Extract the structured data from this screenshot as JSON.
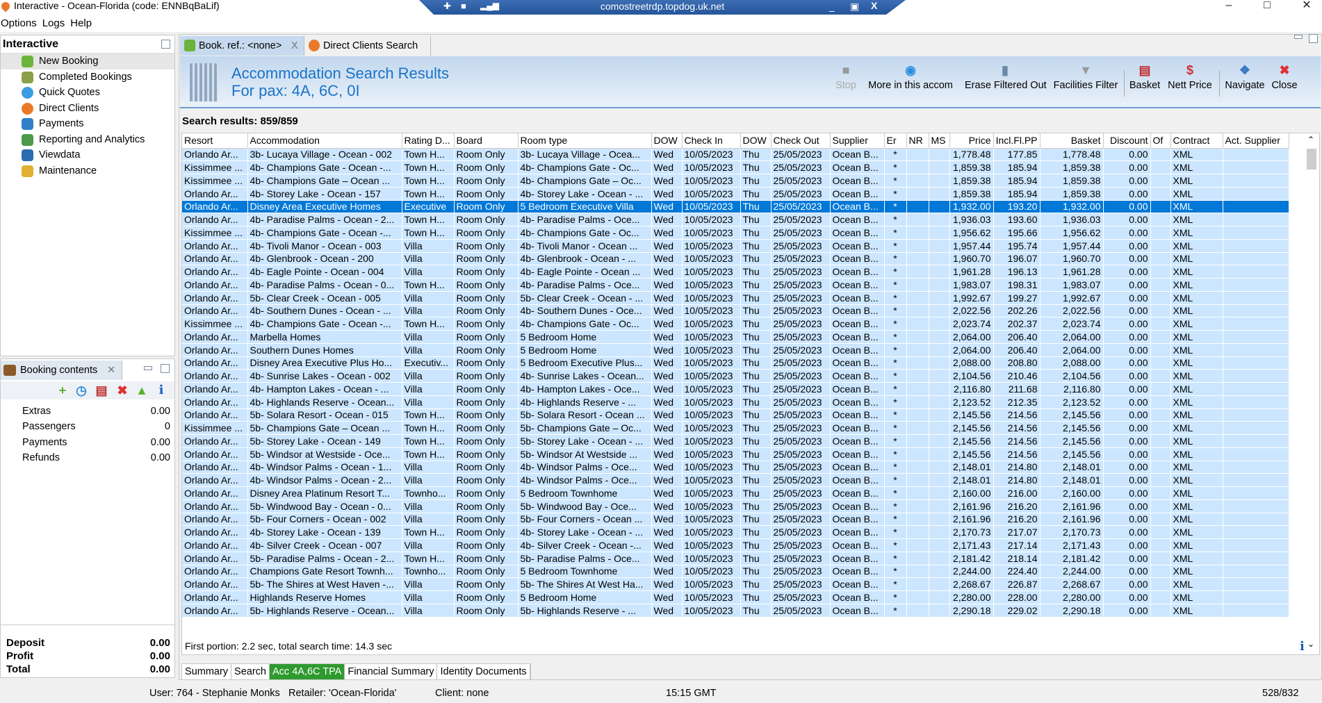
{
  "window": {
    "title": "Interactive - Ocean-Florida (code: ENNBqBaLif)",
    "rdp_host": "comostreetrdp.topdog.uk.net"
  },
  "menu": [
    "Options",
    "Logs",
    "Help"
  ],
  "nav": {
    "title": "Interactive",
    "items": [
      "New Booking",
      "Completed Bookings",
      "Quick Quotes",
      "Direct Clients",
      "Payments",
      "Reporting and Analytics",
      "Viewdata",
      "Maintenance"
    ]
  },
  "booking": {
    "tab": "Booking contents",
    "rows": [
      {
        "k": "Extras",
        "v": "0.00"
      },
      {
        "k": "Passengers",
        "v": "0"
      },
      {
        "k": "Payments",
        "v": "0.00"
      },
      {
        "k": "Refunds",
        "v": "0.00"
      }
    ],
    "totals": [
      {
        "k": "Deposit",
        "v": "0.00"
      },
      {
        "k": "Profit",
        "v": "0.00"
      },
      {
        "k": "Total",
        "v": "0.00"
      }
    ]
  },
  "tabs": [
    {
      "label": "Book. ref.: <none>",
      "close": "X"
    },
    {
      "label": "Direct Clients Search"
    }
  ],
  "header": {
    "title": "Accommodation Search Results",
    "subtitle": "For pax: 4A, 6C, 0I"
  },
  "toolbar": [
    "Stop",
    "More in this accom",
    "Erase Filtered Out",
    "Facilities Filter",
    "Basket",
    "Nett Price",
    "Navigate",
    "Close"
  ],
  "results_label": "Search results: 859/859",
  "columns": [
    "Resort",
    "Accommodation",
    "Rating D...",
    "Board",
    "Room type",
    "DOW",
    "Check In",
    "DOW",
    "Check Out",
    "Supplier",
    "Er",
    "NR",
    "MS",
    "Price",
    "Incl.Fl.PP",
    "Basket",
    "Discount",
    "Of",
    "Contract",
    "Act. Supplier"
  ],
  "common": {
    "board": "Room Only",
    "dow_in": "Wed",
    "check_in": "10/05/2023",
    "dow_out": "Thu",
    "check_out": "25/05/2023",
    "supplier": "Ocean B...",
    "er": "*",
    "nr": "",
    "ms": "",
    "discount": "0.00",
    "of": "",
    "contract": "XML",
    "act_supplier": ""
  },
  "selected_row": 4,
  "rows": [
    [
      "Orlando Ar...",
      "3b- Lucaya Village - Ocean - 002",
      "Town H...",
      "3b- Lucaya Village - Ocea...",
      "1,778.48",
      "177.85",
      "1,778.48"
    ],
    [
      "Kissimmee ...",
      "4b- Champions Gate - Ocean -...",
      "Town H...",
      "4b- Champions Gate - Oc...",
      "1,859.38",
      "185.94",
      "1,859.38"
    ],
    [
      "Kissimmee ...",
      "4b- Champions Gate – Ocean ...",
      "Town H...",
      "4b- Champions Gate – Oc...",
      "1,859.38",
      "185.94",
      "1,859.38"
    ],
    [
      "Orlando Ar...",
      "4b- Storey Lake - Ocean - 157",
      "Town H...",
      "4b- Storey Lake - Ocean - ...",
      "1,859.38",
      "185.94",
      "1,859.38"
    ],
    [
      "Orlando Ar...",
      "Disney Area Executive Homes",
      "Executive",
      "5 Bedroom Executive Villa",
      "1,932.00",
      "193.20",
      "1,932.00"
    ],
    [
      "Orlando Ar...",
      "4b- Paradise Palms - Ocean - 2...",
      "Town H...",
      "4b- Paradise Palms - Oce...",
      "1,936.03",
      "193.60",
      "1,936.03"
    ],
    [
      "Kissimmee ...",
      "4b- Champions Gate - Ocean -...",
      "Town H...",
      "4b- Champions Gate - Oc...",
      "1,956.62",
      "195.66",
      "1,956.62"
    ],
    [
      "Orlando Ar...",
      "4b- Tivoli Manor - Ocean - 003",
      "Villa",
      "4b- Tivoli Manor - Ocean ...",
      "1,957.44",
      "195.74",
      "1,957.44"
    ],
    [
      "Orlando Ar...",
      "4b- Glenbrook - Ocean - 200",
      "Villa",
      "4b- Glenbrook - Ocean - ...",
      "1,960.70",
      "196.07",
      "1,960.70"
    ],
    [
      "Orlando Ar...",
      "4b- Eagle Pointe - Ocean - 004",
      "Villa",
      "4b- Eagle Pointe - Ocean ...",
      "1,961.28",
      "196.13",
      "1,961.28"
    ],
    [
      "Orlando Ar...",
      "4b- Paradise Palms - Ocean - 0...",
      "Town H...",
      "4b- Paradise Palms - Oce...",
      "1,983.07",
      "198.31",
      "1,983.07"
    ],
    [
      "Orlando Ar...",
      "5b- Clear Creek - Ocean - 005",
      "Villa",
      "5b- Clear Creek - Ocean - ...",
      "1,992.67",
      "199.27",
      "1,992.67"
    ],
    [
      "Orlando Ar...",
      "4b- Southern Dunes - Ocean - ...",
      "Villa",
      "4b- Southern Dunes - Oce...",
      "2,022.56",
      "202.26",
      "2,022.56"
    ],
    [
      "Kissimmee ...",
      "4b- Champions Gate - Ocean -...",
      "Town H...",
      "4b- Champions Gate - Oc...",
      "2,023.74",
      "202.37",
      "2,023.74"
    ],
    [
      "Orlando Ar...",
      "Marbella Homes",
      "Villa",
      "5 Bedroom Home",
      "2,064.00",
      "206.40",
      "2,064.00"
    ],
    [
      "Orlando Ar...",
      "Southern Dunes Homes",
      "Villa",
      "5 Bedroom Home",
      "2,064.00",
      "206.40",
      "2,064.00"
    ],
    [
      "Orlando Ar...",
      "Disney Area Executive Plus Ho...",
      "Executiv...",
      "5 Bedroom Executive Plus...",
      "2,088.00",
      "208.80",
      "2,088.00"
    ],
    [
      "Orlando Ar...",
      "4b- Sunrise Lakes - Ocean - 002",
      "Villa",
      "4b- Sunrise Lakes - Ocean...",
      "2,104.56",
      "210.46",
      "2,104.56"
    ],
    [
      "Orlando Ar...",
      "4b- Hampton Lakes - Ocean - ...",
      "Villa",
      "4b- Hampton Lakes - Oce...",
      "2,116.80",
      "211.68",
      "2,116.80"
    ],
    [
      "Orlando Ar...",
      "4b- Highlands Reserve - Ocean...",
      "Villa",
      "4b- Highlands Reserve - ...",
      "2,123.52",
      "212.35",
      "2,123.52"
    ],
    [
      "Orlando Ar...",
      "5b- Solara Resort - Ocean - 015",
      "Town H...",
      "5b- Solara Resort - Ocean ...",
      "2,145.56",
      "214.56",
      "2,145.56"
    ],
    [
      "Kissimmee ...",
      "5b- Champions Gate – Ocean ...",
      "Town H...",
      "5b- Champions Gate – Oc...",
      "2,145.56",
      "214.56",
      "2,145.56"
    ],
    [
      "Orlando Ar...",
      "5b- Storey Lake - Ocean - 149",
      "Town H...",
      "5b- Storey Lake - Ocean - ...",
      "2,145.56",
      "214.56",
      "2,145.56"
    ],
    [
      "Orlando Ar...",
      "5b- Windsor at Westside - Oce...",
      "Town H...",
      "5b- Windsor At Westside ...",
      "2,145.56",
      "214.56",
      "2,145.56"
    ],
    [
      "Orlando Ar...",
      "4b- Windsor Palms - Ocean - 1...",
      "Villa",
      "4b- Windsor Palms - Oce...",
      "2,148.01",
      "214.80",
      "2,148.01"
    ],
    [
      "Orlando Ar...",
      "4b- Windsor Palms - Ocean - 2...",
      "Villa",
      "4b- Windsor Palms - Oce...",
      "2,148.01",
      "214.80",
      "2,148.01"
    ],
    [
      "Orlando Ar...",
      "Disney Area Platinum Resort T...",
      "Townho...",
      "5 Bedroom Townhome",
      "2,160.00",
      "216.00",
      "2,160.00"
    ],
    [
      "Orlando Ar...",
      "5b- Windwood Bay - Ocean - 0...",
      "Villa",
      "5b- Windwood Bay - Oce...",
      "2,161.96",
      "216.20",
      "2,161.96"
    ],
    [
      "Orlando Ar...",
      "5b- Four Corners - Ocean - 002",
      "Villa",
      "5b- Four Corners - Ocean ...",
      "2,161.96",
      "216.20",
      "2,161.96"
    ],
    [
      "Orlando Ar...",
      "4b- Storey Lake - Ocean - 139",
      "Town H...",
      "4b- Storey Lake - Ocean - ...",
      "2,170.73",
      "217.07",
      "2,170.73"
    ],
    [
      "Orlando Ar...",
      "4b- Silver Creek - Ocean - 007",
      "Villa",
      "4b- Silver Creek - Ocean -...",
      "2,171.43",
      "217.14",
      "2,171.43"
    ],
    [
      "Orlando Ar...",
      "5b- Paradise Palms - Ocean - 2...",
      "Town H...",
      "5b- Paradise Palms - Oce...",
      "2,181.42",
      "218.14",
      "2,181.42"
    ],
    [
      "Orlando Ar...",
      "Champions Gate Resort Townh...",
      "Townho...",
      "5 Bedroom Townhome",
      "2,244.00",
      "224.40",
      "2,244.00"
    ],
    [
      "Orlando Ar...",
      "5b- The Shires at West Haven -...",
      "Villa",
      "5b- The Shires At West Ha...",
      "2,268.67",
      "226.87",
      "2,268.67"
    ],
    [
      "Orlando Ar...",
      "Highlands Reserve Homes",
      "Villa",
      "5 Bedroom Home",
      "2,280.00",
      "228.00",
      "2,280.00"
    ],
    [
      "Orlando Ar...",
      "5b- Highlands Reserve - Ocean...",
      "Villa",
      "5b- Highlands Reserve - ...",
      "2,290.18",
      "229.02",
      "2,290.18"
    ]
  ],
  "status_line": "First portion: 2.2 sec, total search time: 14.3 sec",
  "info": "i",
  "bottom_tabs": [
    "Summary",
    "Search",
    "Acc 4A,6C TPA",
    "Financial Summary",
    "Identity Documents"
  ],
  "statusbar": {
    "user": "User: 764 - Stephanie Monks",
    "retailer": "Retailer: 'Ocean-Florida'",
    "client": "Client: none",
    "time": "15:15 GMT",
    "memory": "528/832"
  },
  "colors": {
    "selected": "#0078d7",
    "row": "#cce6ff",
    "accent": "#1a73c8",
    "active_tab": "#2f9a2f"
  }
}
